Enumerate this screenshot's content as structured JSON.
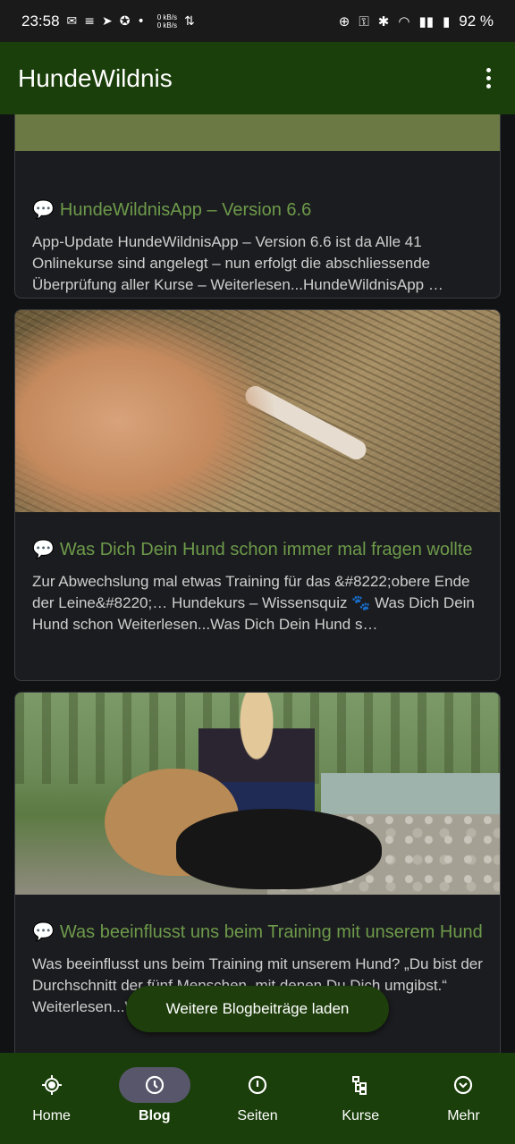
{
  "status_bar": {
    "time": "23:58",
    "net_up": "0 kB/s",
    "net_down": "0 kB/s",
    "battery": "92 %"
  },
  "app_bar": {
    "title": "HundeWildnis"
  },
  "posts": [
    {
      "title": "HundeWildnisApp – Version 6.6",
      "excerpt": "App-Update HundeWildnisApp – Version 6.6 ist da Alle 41 Onlinekurse sind angelegt – nun erfolgt die abschliessende Überprüfung aller Kurse – Weiterlesen...HundeWildnisApp …"
    },
    {
      "title": "Was Dich Dein Hund schon immer mal fragen wollte",
      "excerpt": "Zur Abwechslung mal etwas Training für das &#8222;obere Ende der Leine&#8220;… Hundekurs – Wissensquiz 🐾 Was Dich Dein Hund schon Weiterlesen...Was Dich Dein Hund s…"
    },
    {
      "title": "Was beeinflusst uns beim Training mit unserem Hund",
      "excerpt": "Was beeinflusst uns beim Training mit unserem Hund? „Du bist der Durchschnitt der fünf Menschen, mit denen Du Dich umgibst.“ Weiterlesen...Was beeinflusst uns beim Training …"
    }
  ],
  "load_more_label": "Weitere Blogbeiträge laden",
  "bottom_nav": [
    {
      "label": "Home",
      "icon": "location-target-icon"
    },
    {
      "label": "Blog",
      "icon": "clock-icon",
      "active": true
    },
    {
      "label": "Seiten",
      "icon": "info-icon"
    },
    {
      "label": "Kurse",
      "icon": "course-tree-icon"
    },
    {
      "label": "Mehr",
      "icon": "chevron-circle-icon"
    }
  ]
}
